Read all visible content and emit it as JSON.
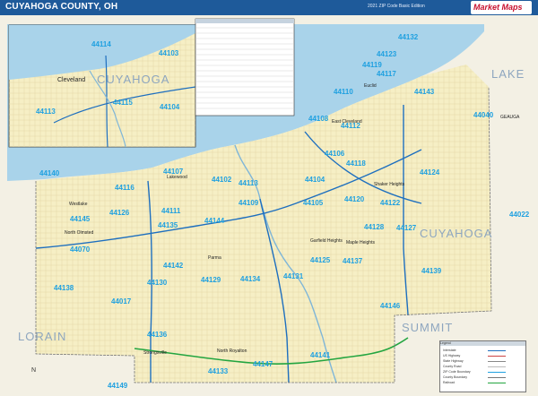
{
  "header": {
    "title": "CUYAHOGA COUNTY, OH",
    "edition": "2021 ZIP Code Basic Edition",
    "brand": "Market Maps",
    "brand_sub": "MAPS"
  },
  "regions": {
    "lake": "LAKE",
    "cuyahoga_main": "CUYAHOGA",
    "cuyahoga_inset": "CUYAHOGA",
    "lorain": "LORAIN",
    "summit": "SUMMIT",
    "geauga": "GEAUGA"
  },
  "cities": {
    "cleveland": "Cleveland",
    "lakewood": "Lakewood",
    "westlake": "Westlake",
    "north_olmsted": "North Olmsted",
    "parma": "Parma",
    "strongsville": "Strongsville",
    "north_royalton": "North Royalton",
    "garfield_heights": "Garfield Heights",
    "maple_heights": "Maple Heights",
    "shaker_heights": "Shaker Heights",
    "east_cleveland": "East Cleveland",
    "euclid": "Euclid"
  },
  "zips": {
    "z44114": "44114",
    "z44103": "44103",
    "z44115": "44115",
    "z44104": "44104",
    "z44113": "44113",
    "z44132": "44132",
    "z44123": "44123",
    "z44117": "44117",
    "z44119": "44119",
    "z44143": "44143",
    "z44040": "44040",
    "z44110": "44110",
    "z44108": "44108",
    "z44112": "44112",
    "z44106": "44106",
    "z44118": "44118",
    "z44124": "44124",
    "z44140": "44140",
    "z44107": "44107",
    "z44102": "44102",
    "z44116": "44116",
    "z44126": "44126",
    "z44111": "44111",
    "z44109": "44109",
    "z44105": "44105",
    "z44120": "44120",
    "z44122": "44122",
    "z44022": "44022",
    "z44145": "44145",
    "z44135": "44135",
    "z44144": "44144",
    "z44127": "44127",
    "z44128": "44128",
    "z44070": "44070",
    "z44142": "44142",
    "z44130": "44130",
    "z44129": "44129",
    "z44134": "44134",
    "z44125": "44125",
    "z44137": "44137",
    "z44131": "44131",
    "z44139": "44139",
    "z44138": "44138",
    "z44017": "44017",
    "z44136": "44136",
    "z44146": "44146",
    "z44141": "44141",
    "z44133": "44133",
    "z44147": "44147",
    "z44149": "44149"
  },
  "legend": {
    "title": "Legend",
    "items": [
      "Interstate",
      "US Highway",
      "State Highway",
      "County Road",
      "ZIP Code Boundary",
      "County Boundary",
      "Railroad"
    ]
  },
  "compass": "N",
  "colors": {
    "land": "#f6efc5",
    "land_light": "#f3f0e4",
    "water": "#a9d3ea",
    "zip_label": "#1fa0e0",
    "interstate": "#1e6fbf",
    "turnpike": "#23a540",
    "header": "#1e5a9a"
  }
}
